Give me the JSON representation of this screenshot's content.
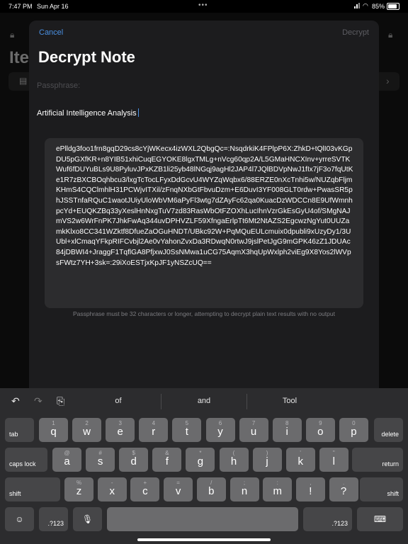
{
  "status_bar": {
    "time": "7:47 PM",
    "date": "Sun Apr 16",
    "battery": "85%"
  },
  "background": {
    "title": "Ite"
  },
  "sheet": {
    "cancel_label": "Cancel",
    "decrypt_label": "Decrypt",
    "heading": "Decrypt Note",
    "passphrase_placeholder": "Passphrase:",
    "note_title": "Artificial Intelligence Analysis",
    "ciphertext": "ePlldg3foo1frn8gqD29cs8cYjWKecx4izWXL2QbgQc=:NsqdrkiK4FPlpP6X:ZhkD+tQlI03vKGpDU5pGXfKR+n8YIB51xhiCuqEGYOKE8lgxTMLg+nVcg60qp2A/L5GMaHNCXInv+yrreSVTKWuf6fDUYuBLs9U8PyluvJPxKZB1li25yb48lNGqj9agHl2JAP4l7JQlBDVpNwJ1fIx7jF3o7fqUtKe1R7zBXCBOqhbcu3/lxgTcTocLFyxDdGcvU4WYZqWqbx6/88ERZE0nXcTnhi5w/NUZqbFljmKHmS4CQClmhlH31PCWjvITXil/zFnqNXbGtFbvuDzm+E6DuvI3YF008GLT0rdw+PwasSR5phJSSTnfaRQuC1waotJUiyUloWbVM6aPyFl3wtg7dZAyFc62qa0KuacDzWDCCn8E9UfWmnhpcYd+EUQKZBq33yXeslHnNxgTuV7zd83RasWbOtFZOXhLucIhnVzrGkEsGyU4of/SMgNAJmVS2w6WrFnPK7JhkFwAq344uvDPHVZLF59XfngaErlpTt6Mt2NtAZS2EgcwzNgYut0UUZamkKlxo8CC341WZktf8DfueZaOGuHNDT/UBkc92W+PqMQuEULcmuix0dpubli9xUzyDy1/3UUbl+xlCmaqYFkpRIFCvbjl2Ae0vYahonZvxDa3RDwqN0rtwJ9jslPetJgG9mGPK46zZ1JDUAc84jDBWI4+JraggF1TqflGA8PfjxwJ0SsNMwa1uCG75AqmX3hqUpWxlph2viEg9X8Yos2lWVpsFWtz7YH+3sk=:29iXoESTjxKpJF1yNSZcUQ==",
    "hint": "Passphrase must be 32 characters or longer, attempting to decrypt plain text results with no output"
  },
  "keyboard": {
    "suggestions": [
      "of",
      "and",
      "Tool"
    ],
    "row1": [
      {
        "main": "q",
        "alt": "1"
      },
      {
        "main": "w",
        "alt": "2"
      },
      {
        "main": "e",
        "alt": "3"
      },
      {
        "main": "r",
        "alt": "4"
      },
      {
        "main": "t",
        "alt": "5"
      },
      {
        "main": "y",
        "alt": "6"
      },
      {
        "main": "u",
        "alt": "7"
      },
      {
        "main": "i",
        "alt": "8"
      },
      {
        "main": "o",
        "alt": "9"
      },
      {
        "main": "p",
        "alt": "0"
      }
    ],
    "row2": [
      {
        "main": "a",
        "alt": "@"
      },
      {
        "main": "s",
        "alt": "#"
      },
      {
        "main": "d",
        "alt": "$"
      },
      {
        "main": "f",
        "alt": "&"
      },
      {
        "main": "g",
        "alt": "*"
      },
      {
        "main": "h",
        "alt": "("
      },
      {
        "main": "j",
        "alt": ")"
      },
      {
        "main": "k",
        "alt": "'"
      },
      {
        "main": "l",
        "alt": "\""
      }
    ],
    "row3": [
      {
        "main": "z",
        "alt": "%"
      },
      {
        "main": "x",
        "alt": "-"
      },
      {
        "main": "c",
        "alt": "+"
      },
      {
        "main": "v",
        "alt": "="
      },
      {
        "main": "b",
        "alt": "/"
      },
      {
        "main": "n",
        "alt": ";"
      },
      {
        "main": "m",
        "alt": ":"
      },
      {
        "main": "!",
        "alt": ","
      },
      {
        "main": "?",
        "alt": "."
      }
    ],
    "tab": "tab",
    "delete": "delete",
    "caps_lock": "caps lock",
    "return": "return",
    "shift": "shift",
    "numbers": ".?123"
  }
}
